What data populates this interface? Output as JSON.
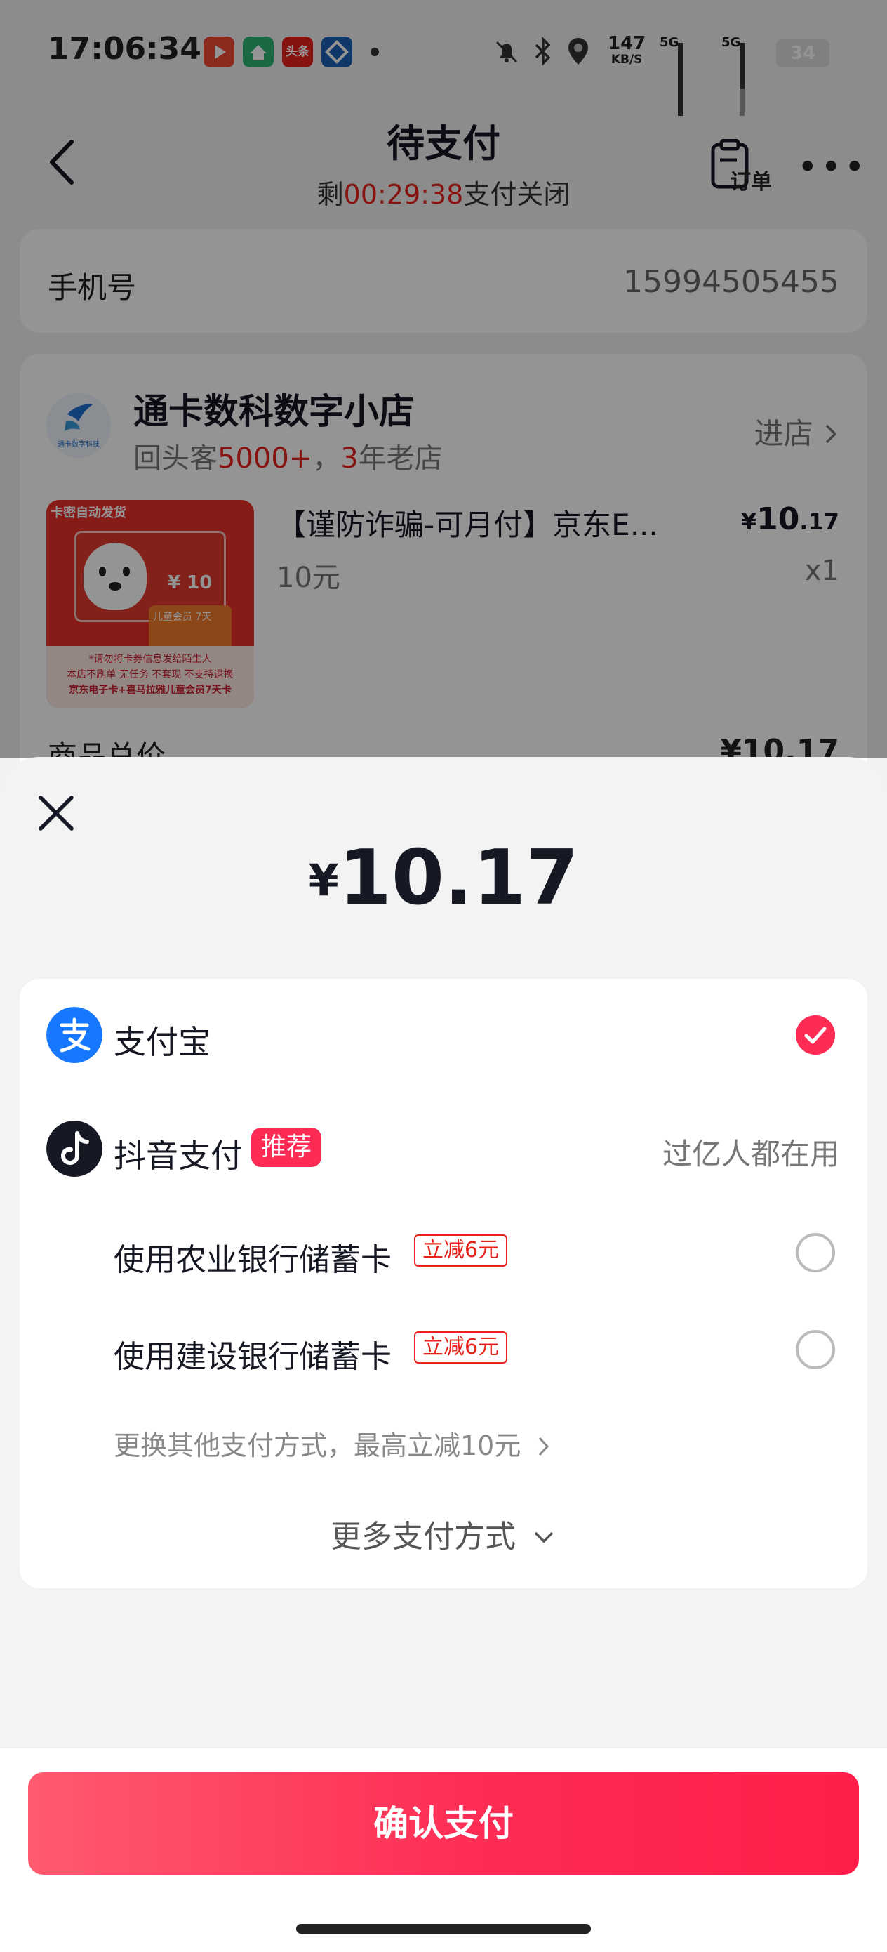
{
  "status_bar": {
    "time": "17:06:34",
    "apps": [
      {
        "icon": "video-app-icon",
        "label": "",
        "color": "#f04a33"
      },
      {
        "icon": "home-app-icon",
        "label": "",
        "color": "#2bb673"
      },
      {
        "icon": "toutiao-app-icon",
        "label": "头条",
        "color": "#e8221c"
      },
      {
        "icon": "bank-app-icon",
        "label": "",
        "color": "#1a5fb4"
      }
    ],
    "net_speed_value": "147",
    "net_speed_unit": "KB/S",
    "sim1_label": "5G",
    "sim2_label": "5G",
    "battery": "34"
  },
  "header": {
    "title": "待支付",
    "countdown_prefix": "剩",
    "countdown": "00:29:38",
    "countdown_suffix": "支付关闭",
    "order_label": "订单"
  },
  "phone": {
    "label": "手机号",
    "value": "15994505455"
  },
  "shop": {
    "name": "通卡数科数字小店",
    "logo_text": "通卡数字科技",
    "tag_prefix": "回头客",
    "repeat_count": "5000+",
    "tag_sep": "，",
    "years": "3",
    "years_suffix": "年老店",
    "enter_label": "进店"
  },
  "product": {
    "title": "【谨防诈骗-可月付】京东E...",
    "price_symbol": "¥",
    "price_int": "10",
    "price_dec": ".17",
    "spec": "10元",
    "qty": "x1",
    "thumb_top": "卡密自动发货",
    "thumb_value": "¥ 10",
    "thumb_badge": "儿童会员 7天",
    "thumb_notice": "*请勿将卡券信息发给陌生人",
    "thumb_rules": "本店不刷单 无任务 不套现 不支持退换",
    "thumb_caption": "京东电子卡+喜马拉雅儿童会员7天卡"
  },
  "summary": {
    "total_label": "商品总价",
    "total_value": "¥10.17"
  },
  "sheet": {
    "currency": "¥",
    "amount": "10.17",
    "methods": [
      {
        "name": "支付宝",
        "selected": true
      },
      {
        "name": "抖音支付",
        "badge": "推荐",
        "hint": "过亿人都在用"
      }
    ],
    "banks": [
      {
        "name": "使用农业银行储蓄卡",
        "discount": "立减6元"
      },
      {
        "name": "使用建设银行储蓄卡",
        "discount": "立减6元"
      }
    ],
    "other_methods": "更换其他支付方式，最高立减10元",
    "more_methods": "更多支付方式",
    "confirm": "确认支付"
  },
  "colors": {
    "accent": "#fe2c55",
    "price_red": "#e8221c",
    "alipay_blue": "#1677ff"
  }
}
